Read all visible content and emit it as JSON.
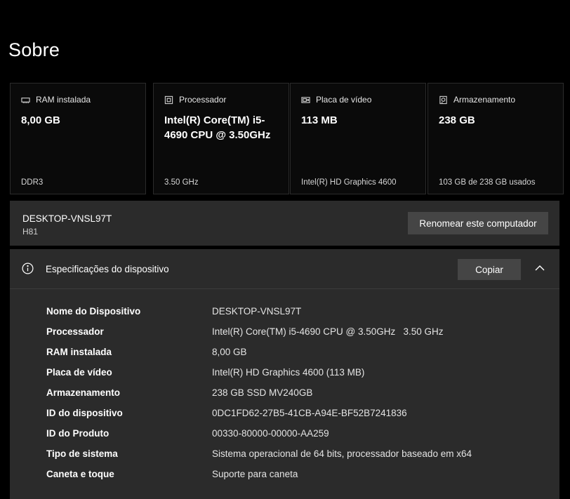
{
  "page": {
    "title": "Sobre"
  },
  "cards": [
    {
      "label": "RAM instalada",
      "icon": "memory-icon",
      "value": "8,00 GB",
      "footer": "DDR3"
    },
    {
      "label": "Processador",
      "icon": "processor-icon",
      "value": "Intel(R) Core(TM) i5-4690 CPU @ 3.50GHz",
      "footer": "3.50 GHz"
    },
    {
      "label": "Placa de vídeo",
      "icon": "graphics-card-icon",
      "value": "113 MB",
      "footer": "Intel(R) HD Graphics 4600"
    },
    {
      "label": "Armazenamento",
      "icon": "storage-icon",
      "value": "238 GB",
      "footer": "103 GB de 238 GB usados"
    }
  ],
  "device": {
    "name": "DESKTOP-VNSL97T",
    "model": "H81",
    "rename_label": "Renomear este computador"
  },
  "specs": {
    "title": "Especificações do dispositivo",
    "copy_label": "Copiar",
    "rows": [
      {
        "label": "Nome do Dispositivo",
        "value": "DESKTOP-VNSL97T"
      },
      {
        "label": "Processador",
        "value": "Intel(R) Core(TM) i5-4690 CPU @ 3.50GHz   3.50 GHz"
      },
      {
        "label": "RAM instalada",
        "value": "8,00 GB"
      },
      {
        "label": "Placa de vídeo",
        "value": "Intel(R) HD Graphics 4600 (113 MB)"
      },
      {
        "label": "Armazenamento",
        "value": "238 GB SSD MV240GB"
      },
      {
        "label": "ID do dispositivo",
        "value": "0DC1FD62-27B5-41CB-A94E-BF52B7241836"
      },
      {
        "label": "ID do Produto",
        "value": "00330-80000-00000-AA259"
      },
      {
        "label": "Tipo de sistema",
        "value": "Sistema operacional de 64 bits, processador baseado em x64"
      },
      {
        "label": "Caneta e toque",
        "value": "Suporte para caneta"
      }
    ]
  },
  "colors": {
    "background": "#000000",
    "panel": "#2b2b2b",
    "button": "#454545"
  }
}
